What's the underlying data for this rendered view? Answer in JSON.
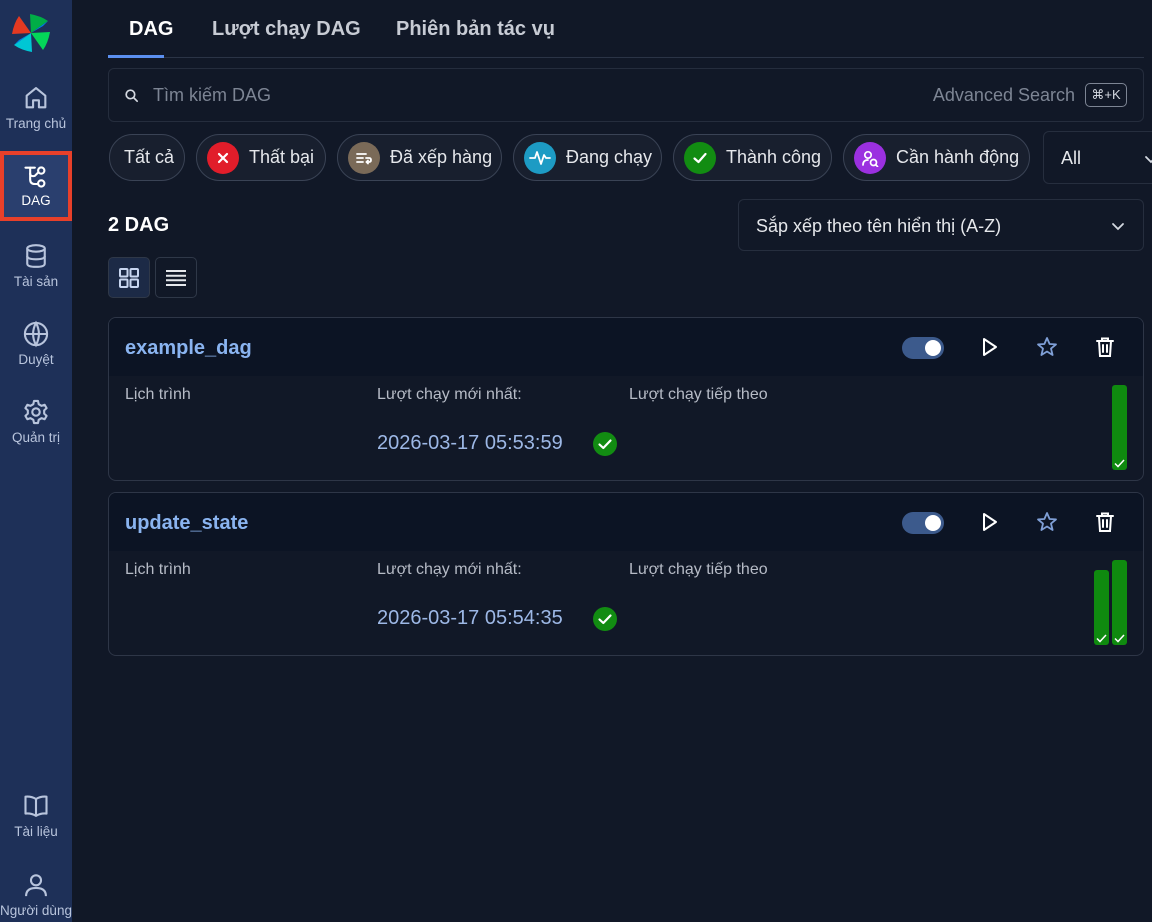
{
  "sidebar": {
    "items": [
      {
        "label": "Trang chủ",
        "icon": "home-icon"
      },
      {
        "label": "DAG",
        "icon": "dag-icon",
        "active": true
      },
      {
        "label": "Tài sản",
        "icon": "database-icon"
      },
      {
        "label": "Duyệt",
        "icon": "globe-icon"
      },
      {
        "label": "Quản trị",
        "icon": "gear-icon"
      },
      {
        "label": "Tài liệu",
        "icon": "book-icon"
      },
      {
        "label": "Người dùng",
        "icon": "user-icon"
      }
    ]
  },
  "tabs": [
    "DAG",
    "Lượt chạy DAG",
    "Phiên bản tác vụ"
  ],
  "search": {
    "placeholder": "Tìm kiếm DAG",
    "advanced": "Advanced Search",
    "shortcut": "⌘+K"
  },
  "filters": [
    {
      "label": "Tất cả",
      "icon": null,
      "color": null
    },
    {
      "label": "Thất bại",
      "icon": "x-icon",
      "color": "#e11d2a"
    },
    {
      "label": "Đã xếp hàng",
      "icon": "queue-icon",
      "color": "#7a6a58"
    },
    {
      "label": "Đang chạy",
      "icon": "activity-icon",
      "color": "#1d9bc4"
    },
    {
      "label": "Thành công",
      "icon": "check-icon",
      "color": "#128c12"
    },
    {
      "label": "Cần hành động",
      "icon": "user-action-icon",
      "color": "#9b30e0"
    }
  ],
  "tag_filter": {
    "value": "All"
  },
  "dag_count": "2 DAG",
  "sort": {
    "value": "Sắp xếp theo tên hiển thị (A-Z)"
  },
  "labels": {
    "schedule": "Lịch trình",
    "latest_run": "Lượt chạy mới nhất:",
    "next_run": "Lượt chạy tiếp theo"
  },
  "dags": [
    {
      "name": "example_dag",
      "latest_run": "2026-03-17 05:53:59",
      "status": "success",
      "enabled": true,
      "recent_runs": [
        "success"
      ]
    },
    {
      "name": "update_state",
      "latest_run": "2026-03-17 05:54:35",
      "status": "success",
      "enabled": true,
      "recent_runs": [
        "success",
        "success"
      ]
    }
  ],
  "colors": {
    "accent": "#5b8ff0",
    "sidebar": "#1e3058",
    "success": "#0f8a0f",
    "active_outline": "#e8402a"
  }
}
